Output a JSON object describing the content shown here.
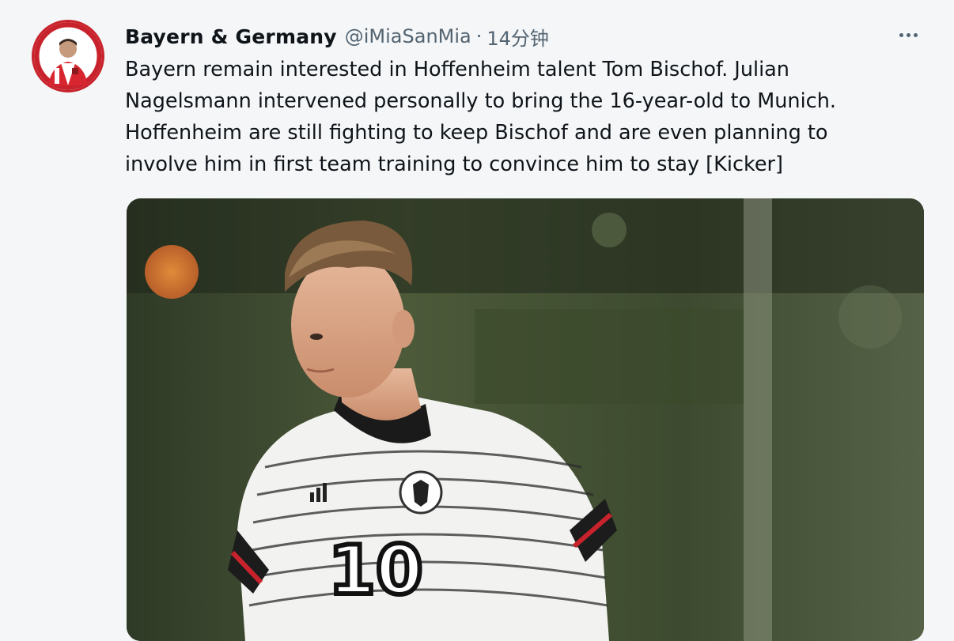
{
  "tweet": {
    "author_name": "Bayern & Germany",
    "handle": "@iMiaSanMia",
    "separator": "·",
    "time": "14分钟",
    "text_lines": [
      "Bayern remain interested in Hoffenheim talent Tom Bischof. Julian",
      "Nagelsmann intervened personally to bring the 16-year-old to Munich.",
      "Hoffenheim are still fighting to keep Bischof and are even planning to",
      "involve him in first team training to convince him to stay [Kicker]"
    ],
    "more_icon": "more-horizontal-icon",
    "media": {
      "shirt_number": "10",
      "kit_brand": "adidas"
    }
  },
  "colors": {
    "background": "#f4f6f8",
    "text_primary": "#0f1419",
    "text_secondary": "#536471",
    "avatar_ring": "#c8232c"
  }
}
